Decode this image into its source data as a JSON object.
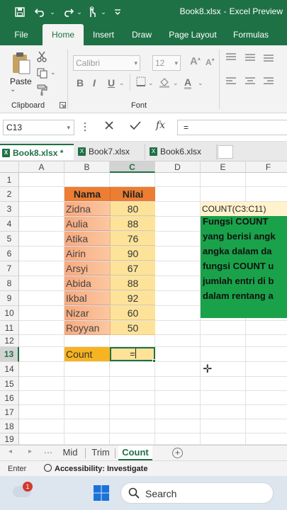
{
  "window": {
    "title": "Book8.xlsx",
    "separator": "-",
    "app": "Excel Preview",
    "qat_dropdown": "⌄"
  },
  "ribbon_tabs": [
    "File",
    "Home",
    "Insert",
    "Draw",
    "Page Layout",
    "Formulas"
  ],
  "ribbon": {
    "paste_label": "Paste",
    "font_name": "Calibri",
    "font_size": "12",
    "bold": "B",
    "italic": "I",
    "underline": "U",
    "font_color_letter": "A",
    "grow_font": "A",
    "shrink_font": "A",
    "clipboard_label": "Clipboard",
    "font_label": "Font"
  },
  "formula_bar": {
    "name_box": "C13",
    "formula": "="
  },
  "workbook_tabs": [
    "Book8.xlsx *",
    "Book7.xlsx",
    "Book6.xlsx"
  ],
  "columns": [
    "A",
    "B",
    "C",
    "D",
    "E",
    "F"
  ],
  "rows": [
    "1",
    "2",
    "3",
    "4",
    "5",
    "6",
    "7",
    "8",
    "9",
    "10",
    "11",
    "12",
    "13",
    "14",
    "15",
    "16",
    "17",
    "18",
    "19"
  ],
  "table": {
    "header_name": "Nama",
    "header_value": "Nilai",
    "names": [
      "Zidna",
      "Aulia",
      "Atika",
      "Airin",
      "Arsyi",
      "Abida",
      "Ikbal",
      "Nizar",
      "Royyan"
    ],
    "values": [
      "80",
      "88",
      "76",
      "90",
      "67",
      "88",
      "92",
      "60",
      "50"
    ]
  },
  "count": {
    "label": "Count",
    "entry": "="
  },
  "note": {
    "ref": "COUNT(C3:C11)",
    "lines": [
      "Fungsi COUNT",
      "yang berisi angk",
      "angka dalam da",
      "fungsi COUNT u",
      "jumlah entri di b",
      "dalam rentang a"
    ]
  },
  "sheets": [
    "Mid",
    "Trim",
    "Count"
  ],
  "active_sheet": "Count",
  "status": {
    "mode": "Enter",
    "accessibility": "Accessibility: Investigate"
  },
  "taskbar": {
    "badge": "1",
    "search": "Search"
  },
  "colors": {
    "excel_green": "#1e7145",
    "header_orange": "#ec7d33",
    "value_yellow": "#fde39a",
    "note_green": "#19a24a"
  }
}
